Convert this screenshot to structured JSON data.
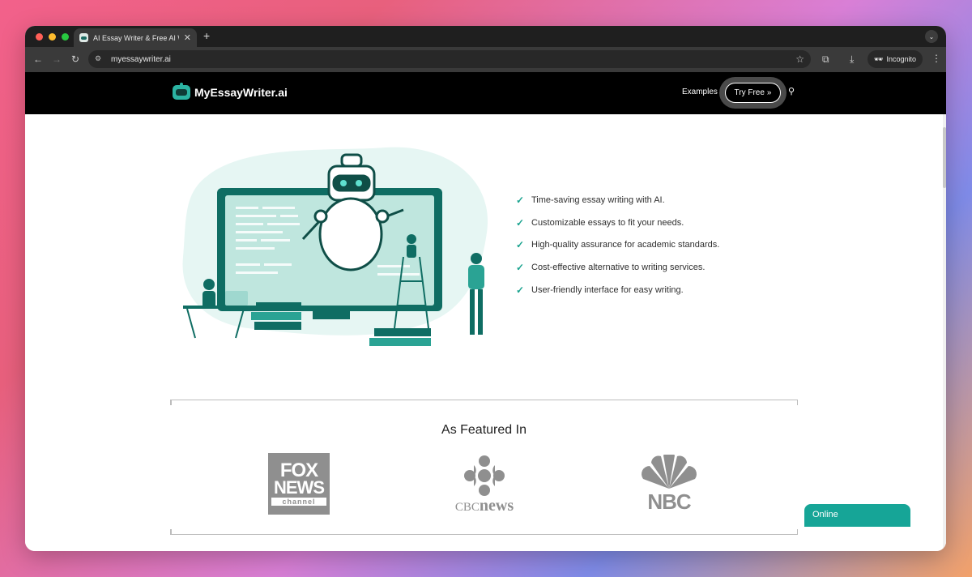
{
  "browser": {
    "tab_title": "AI Essay Writer & Free AI Wri",
    "tab_close": "✕",
    "new_tab": "+",
    "url": "myessaywriter.ai",
    "incognito_label": "Incognito",
    "traffic_light_colors": [
      "#ff5f57",
      "#febc2e",
      "#28c840"
    ]
  },
  "site": {
    "logo_text": "MyEssayWriter.ai",
    "nav_examples": "Examples",
    "try_free": "Try Free",
    "try_free_arrow": "»"
  },
  "features": [
    "Time-saving essay writing with AI.",
    "Customizable essays to fit your needs.",
    "High-quality assurance for academic standards.",
    "Cost-effective alternative to writing services.",
    "User-friendly interface for easy writing."
  ],
  "featured": {
    "heading": "As Featured In",
    "fox": [
      "FOX",
      "NEWS",
      "channel"
    ],
    "cbc": [
      "CBC",
      "news"
    ],
    "nbc": "NBC"
  },
  "chat": {
    "status": "Online"
  },
  "colors": {
    "accent": "#16a597",
    "header_bg": "#000000",
    "check": "#1aa38f"
  }
}
